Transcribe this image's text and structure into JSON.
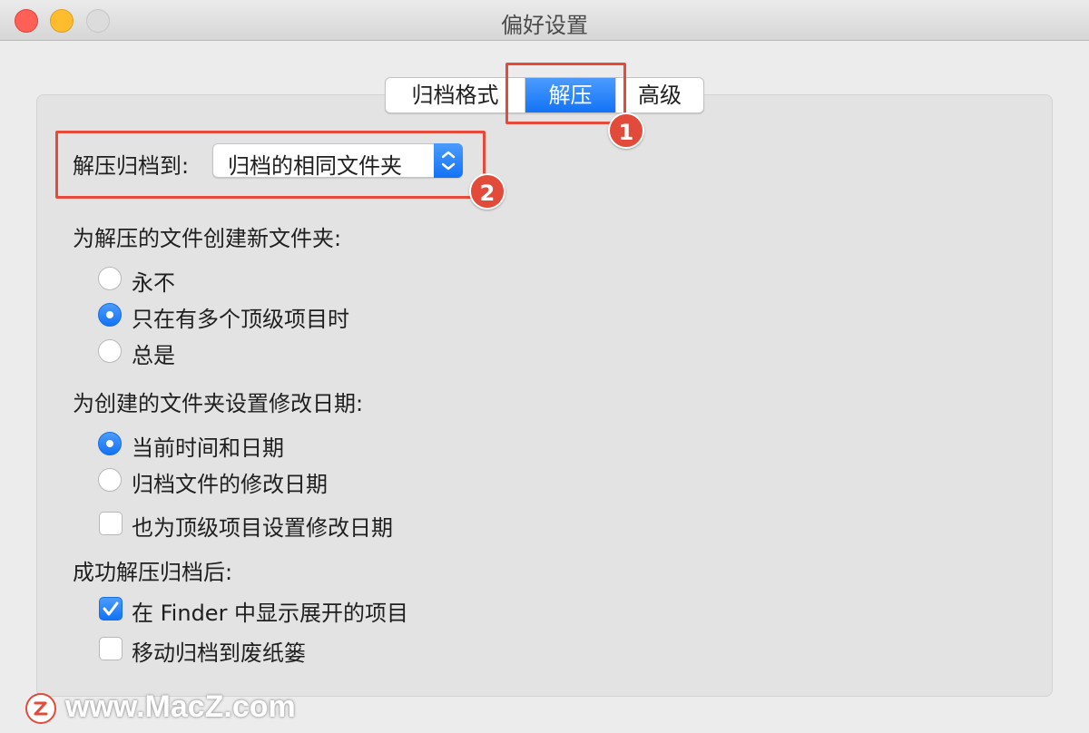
{
  "window": {
    "title": "偏好设置"
  },
  "tabs": [
    {
      "label": "归档格式"
    },
    {
      "label": "解压"
    },
    {
      "label": "高级"
    }
  ],
  "annotations": {
    "badge1": "1",
    "badge2": "2"
  },
  "extract_to": {
    "label": "解压归档到:",
    "value": "归档的相同文件夹"
  },
  "new_folder": {
    "heading": "为解压的文件创建新文件夹:",
    "options": [
      {
        "label": "永不",
        "selected": false
      },
      {
        "label": "只在有多个顶级项目时",
        "selected": true
      },
      {
        "label": "总是",
        "selected": false
      }
    ]
  },
  "folder_date": {
    "heading": "为创建的文件夹设置修改日期:",
    "options": [
      {
        "label": "当前时间和日期",
        "selected": true
      },
      {
        "label": "归档文件的修改日期",
        "selected": false
      }
    ],
    "checkbox": {
      "label": "也为顶级项目设置修改日期",
      "checked": false
    }
  },
  "after_success": {
    "heading": "成功解压归档后:",
    "checkboxes": [
      {
        "label": "在 Finder 中显示展开的项目",
        "checked": true
      },
      {
        "label": "移动归档到废纸篓",
        "checked": false
      }
    ]
  },
  "watermark": {
    "text": "www.MacZ.com"
  },
  "colors": {
    "accent": "#1273f5",
    "highlight": "#e64a3b"
  }
}
